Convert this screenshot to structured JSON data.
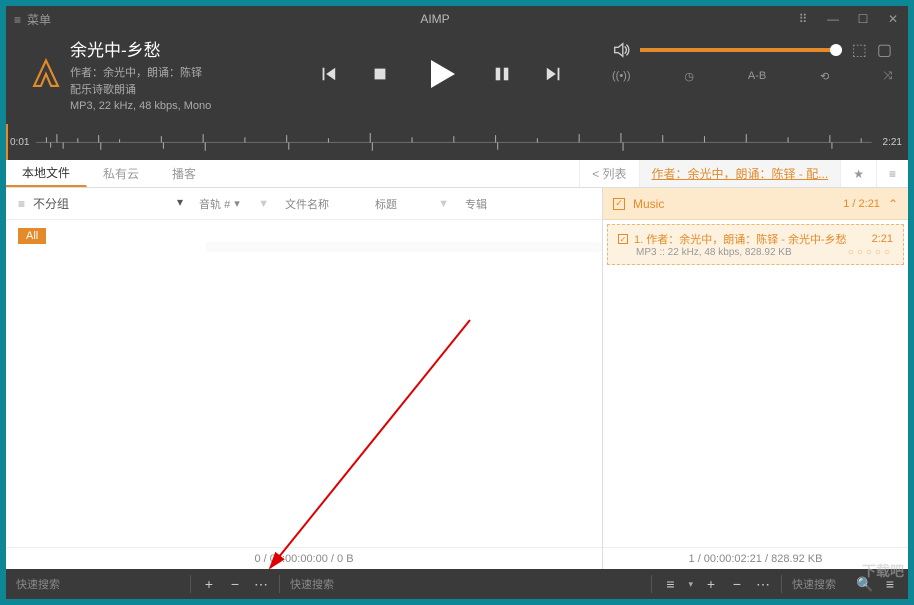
{
  "titlebar": {
    "menu": "菜单",
    "title": "AIMP"
  },
  "track": {
    "title": "余光中-乡愁",
    "author": "作者：余光中，朗诵：陈铎",
    "album": "配乐诗歌朗诵",
    "format": "MP3, 22 kHz, 48 kbps, Mono"
  },
  "wave": {
    "left": "0:01",
    "right": "2:21"
  },
  "tabs": {
    "local": "本地文件",
    "cloud": "私有云",
    "podcast": "播客",
    "list": "< 列表",
    "info": "作者：余光中，朗诵：陈铎 - 配..."
  },
  "group": {
    "label": "不分组"
  },
  "cols": {
    "track": "音轨 #",
    "filename": "文件名称",
    "title": "标题",
    "album": "专辑"
  },
  "all": "All",
  "leftstatus": "0 / 00:00:00:00 / 0 B",
  "playlist": {
    "name": "Music",
    "count": "1 / 2:21",
    "item_title": "1. 作者：余光中，朗诵：陈铎 - 余光中-乡愁",
    "item_dur": "2:21",
    "item_meta": "MP3 :: 22 kHz, 48 kbps, 828.92 KB"
  },
  "rightstatus": "1 / 00:00:02:21 / 828.92 KB",
  "search": "快速搜索",
  "extra": {
    "ab": "A-B"
  },
  "watermark": "下载吧"
}
